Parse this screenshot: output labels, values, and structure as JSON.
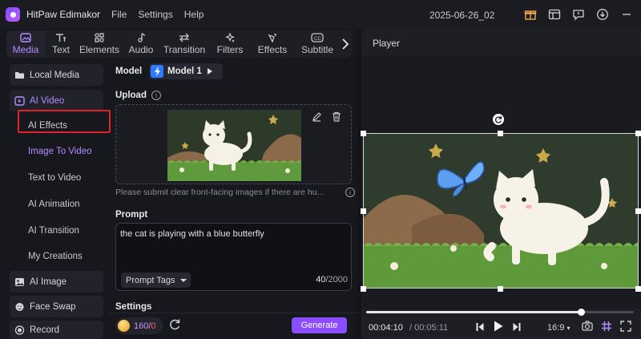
{
  "titlebar": {
    "app_name": "HitPaw Edimakor",
    "menu": [
      "File",
      "Settings",
      "Help"
    ],
    "project_title": "2025-06-26_02"
  },
  "tabs": [
    {
      "label": "Media",
      "icon": "media-icon",
      "active": true
    },
    {
      "label": "Text",
      "icon": "text-icon"
    },
    {
      "label": "Elements",
      "icon": "elements-icon"
    },
    {
      "label": "Audio",
      "icon": "audio-icon"
    },
    {
      "label": "Transition",
      "icon": "transition-icon"
    },
    {
      "label": "Filters",
      "icon": "filters-icon"
    },
    {
      "label": "Effects",
      "icon": "effects-icon"
    },
    {
      "label": "Subtitle",
      "icon": "subtitle-icon"
    }
  ],
  "sidebar": {
    "local_media": "Local Media",
    "ai_video": "AI Video",
    "sub_items": [
      "AI Effects",
      "Image To Video",
      "Text to Video",
      "AI Animation",
      "AI Transition",
      "My Creations"
    ],
    "selected": "Image To Video",
    "ai_image": "AI Image",
    "face_swap": "Face Swap",
    "record": "Record"
  },
  "main": {
    "model_label": "Model",
    "model_value": "Model 1",
    "upload_label": "Upload",
    "upload_hint": "Please submit clear front-facing images if there are hu...",
    "prompt_label": "Prompt",
    "prompt_text": "the cat is playing with a blue butterfly",
    "prompt_tags": "Prompt Tags",
    "char_used": "40",
    "char_max": "/2000",
    "settings_label": "Settings"
  },
  "bottom": {
    "credits_have": "160",
    "credits_sep": "/",
    "credits_cost": "0",
    "generate": "Generate"
  },
  "player": {
    "title": "Player",
    "time_current": "00:04:10",
    "time_total": "/ 00:05:11",
    "aspect_ratio": "16:9",
    "progress_fraction": 0.803
  },
  "colors": {
    "accent": "#8a4dff",
    "accent_text": "#b48cff",
    "highlight": "#e0242c"
  }
}
